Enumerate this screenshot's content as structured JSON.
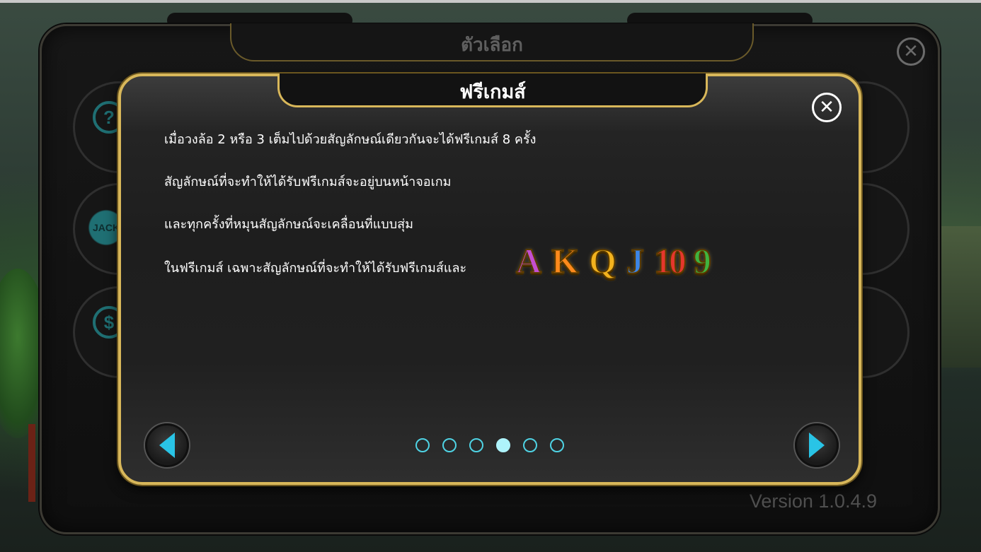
{
  "options_panel": {
    "title": "ตัวเลือก",
    "version": "Version 1.0.4.9",
    "side_buttons": [
      "help-icon",
      "jackpot-icon",
      "dollar-refresh-icon"
    ]
  },
  "dialog": {
    "title": "ฟรีเกมส์",
    "lines": [
      "เมื่อวงล้อ 2 หรือ 3 เต็มไปด้วยสัญลักษณ์เดียวกันจะได้ฟรีเกมส์ 8 ครั้ง",
      "สัญลักษณ์ที่จะทำให้ได้รับฟรีเกมส์จะอยู่บนหน้าจอเกม",
      "และทุกครั้งที่หมุนสัญลักษณ์จะเคลื่อนที่แบบสุ่ม",
      "ในฟรีเกมส์ เฉพาะสัญลักษณ์ที่จะทำให้ได้รับฟรีเกมส์และ"
    ],
    "symbols": [
      "A",
      "K",
      "Q",
      "J",
      "10",
      "9"
    ],
    "page_total": 6,
    "page_current": 4
  },
  "colors": {
    "gold_border": "#d8b75a",
    "dot_active": "#aef3fb",
    "arrow": "#29c4e6"
  }
}
